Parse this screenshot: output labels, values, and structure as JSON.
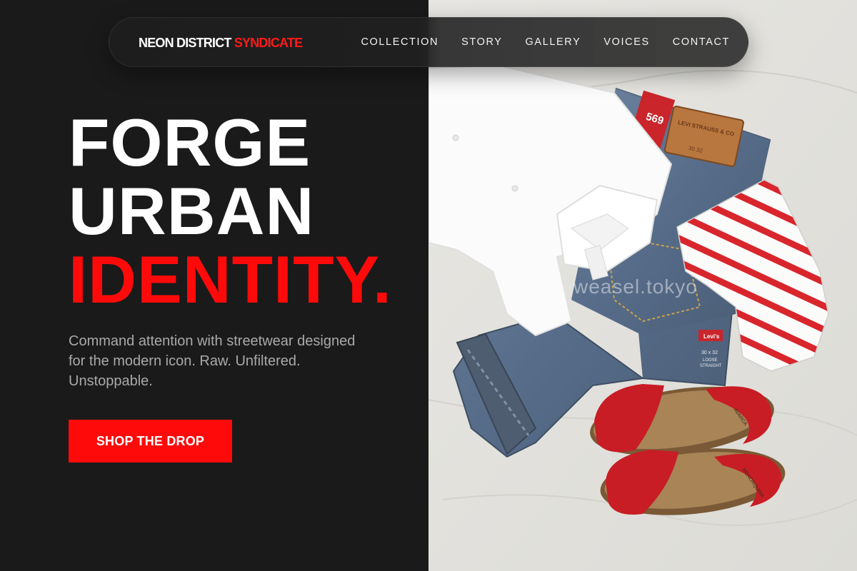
{
  "brand": {
    "name": "NEON DISTRICT",
    "accent": "SYNDICATE",
    "accent_color": "#ff0a0a"
  },
  "nav": {
    "items": [
      "COLLECTION",
      "STORY",
      "GALLERY",
      "VOICES",
      "CONTACT"
    ]
  },
  "hero": {
    "line1": "FORGE",
    "line2": "URBAN",
    "line3": "IDENTITY.",
    "subtext": "Command attention with streetwear designed for the modern icon. Raw. Unfiltered. Unstoppable.",
    "cta": "SHOP THE DROP"
  },
  "photo": {
    "watermark": "weasel.tokyo",
    "jeans_tag_number": "569",
    "jeans_tag_brand": "LEVI'S",
    "patch_text": "LEVI STRAUSS & CO",
    "patch_size": "30  32",
    "label_brand": "Levi's",
    "label_size": "30 x 32",
    "label_fit_1": "LOOSE",
    "label_fit_2": "STRAIGHT",
    "sandal_text_1": "AVARCA",
    "sandal_text_2": "MENORQUINA"
  },
  "colors": {
    "background": "#1a1a1a",
    "accent": "#ff0a0a",
    "muted_text": "#a9a9a9"
  }
}
